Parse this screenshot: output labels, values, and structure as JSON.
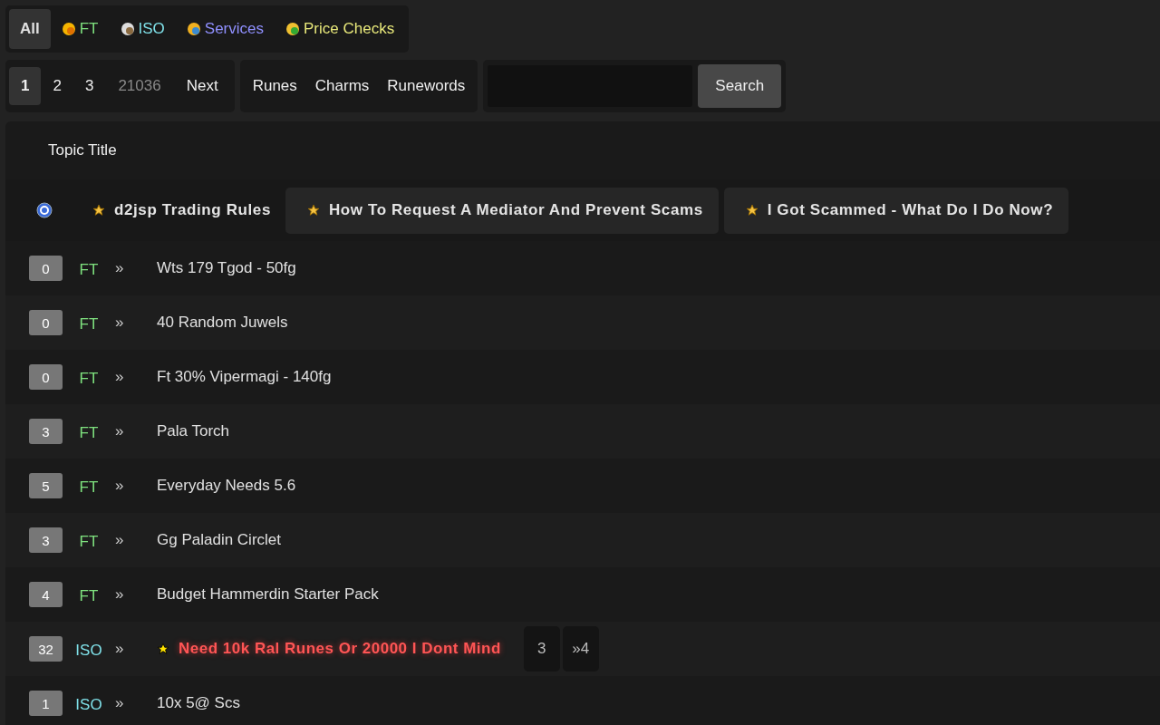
{
  "categories": [
    {
      "label": "All",
      "selected": true,
      "kind": "all",
      "color": "#e0e0e0"
    },
    {
      "label": "FT",
      "selected": false,
      "kind": "ft",
      "color": "#7ee07e"
    },
    {
      "label": "ISO",
      "selected": false,
      "kind": "iso",
      "color": "#7fe0e8"
    },
    {
      "label": "Services",
      "selected": false,
      "kind": "services",
      "color": "#9090ff"
    },
    {
      "label": "Price Checks",
      "selected": false,
      "kind": "price",
      "color": "#e8e87a"
    }
  ],
  "pagination": [
    {
      "label": "1",
      "selected": true,
      "kind": "page"
    },
    {
      "label": "2",
      "selected": false,
      "kind": "page"
    },
    {
      "label": "3",
      "selected": false,
      "kind": "page"
    },
    {
      "label": "21036",
      "selected": false,
      "kind": "last"
    },
    {
      "label": "Next",
      "selected": false,
      "kind": "page"
    }
  ],
  "item_links": [
    "Runes",
    "Charms",
    "Runewords"
  ],
  "search": {
    "button": "Search"
  },
  "table": {
    "header": "Topic Title",
    "pinned": [
      {
        "title": "d2jsp Trading Rules",
        "boxed": false
      },
      {
        "title": "How To Request A Mediator And Prevent Scams",
        "boxed": true
      },
      {
        "title": "I Got Scammed - What Do I Do Now?",
        "boxed": true
      }
    ],
    "rows": [
      {
        "count": "0",
        "tag": "FT",
        "kind": "ft",
        "marker": "»",
        "title": "Wts 179 Tgod - 50fg",
        "hot": false
      },
      {
        "count": "0",
        "tag": "FT",
        "kind": "ft",
        "marker": "»",
        "title": "40 Random Juwels",
        "hot": false
      },
      {
        "count": "0",
        "tag": "FT",
        "kind": "ft",
        "marker": "»",
        "title": "Ft 30% Vipermagi - 140fg",
        "hot": false
      },
      {
        "count": "3",
        "tag": "FT",
        "kind": "ft",
        "marker": "»",
        "title": "Pala Torch",
        "hot": false
      },
      {
        "count": "5",
        "tag": "FT",
        "kind": "ft",
        "marker": "»",
        "title": "Everyday Needs 5.6",
        "hot": false
      },
      {
        "count": "3",
        "tag": "FT",
        "kind": "ft",
        "marker": "»",
        "title": "Gg Paladin Circlet",
        "hot": false
      },
      {
        "count": "4",
        "tag": "FT",
        "kind": "ft",
        "marker": "»",
        "title": "Budget Hammerdin Starter Pack",
        "hot": false
      },
      {
        "count": "32",
        "tag": "ISO",
        "kind": "iso",
        "marker": "»",
        "title": "Need 10k Ral Runes Or 20000 I Dont Mind",
        "hot": true,
        "pages": [
          "3",
          "»4"
        ]
      },
      {
        "count": "1",
        "tag": "ISO",
        "kind": "iso",
        "marker": "»",
        "title": "10x 5@ Scs",
        "hot": false
      }
    ]
  }
}
